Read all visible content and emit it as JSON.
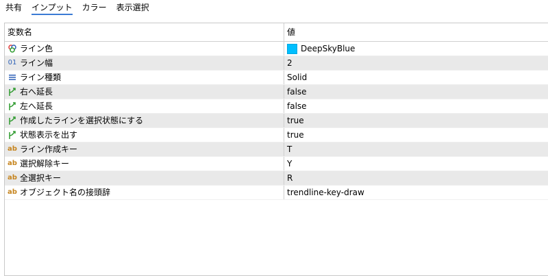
{
  "tabs": [
    {
      "label": "共有",
      "active": false
    },
    {
      "label": "インプット",
      "active": true
    },
    {
      "label": "カラー",
      "active": false
    },
    {
      "label": "表示選択",
      "active": false
    }
  ],
  "table": {
    "columns": [
      "変数名",
      "値"
    ],
    "rows": [
      {
        "icon": "triple-dot-icon",
        "name": "ライン色",
        "value": "DeepSkyBlue",
        "value_color": "#00bfff"
      },
      {
        "icon": "numeric-icon",
        "icon_text": "01",
        "name": "ライン幅",
        "value": "2"
      },
      {
        "icon": "list-icon",
        "name": "ライン種類",
        "value": "Solid"
      },
      {
        "icon": "branch-arrow-icon",
        "name": "右へ延長",
        "value": "false"
      },
      {
        "icon": "branch-arrow-icon",
        "name": "左へ延長",
        "value": "false"
      },
      {
        "icon": "branch-arrow-icon",
        "name": "作成したラインを選択状態にする",
        "value": "true"
      },
      {
        "icon": "branch-arrow-icon",
        "name": "状態表示を出す",
        "value": "true"
      },
      {
        "icon": "text-ab-icon",
        "icon_text": "ab",
        "name": "ライン作成キー",
        "value": "T"
      },
      {
        "icon": "text-ab-icon",
        "icon_text": "ab",
        "name": "選択解除キー",
        "value": "Y"
      },
      {
        "icon": "text-ab-icon",
        "icon_text": "ab",
        "name": "全選択キー",
        "value": "R"
      },
      {
        "icon": "text-ab-icon",
        "icon_text": "ab",
        "name": "オブジェクト名の接頭辞",
        "value": "trendline-key-draw"
      }
    ]
  }
}
